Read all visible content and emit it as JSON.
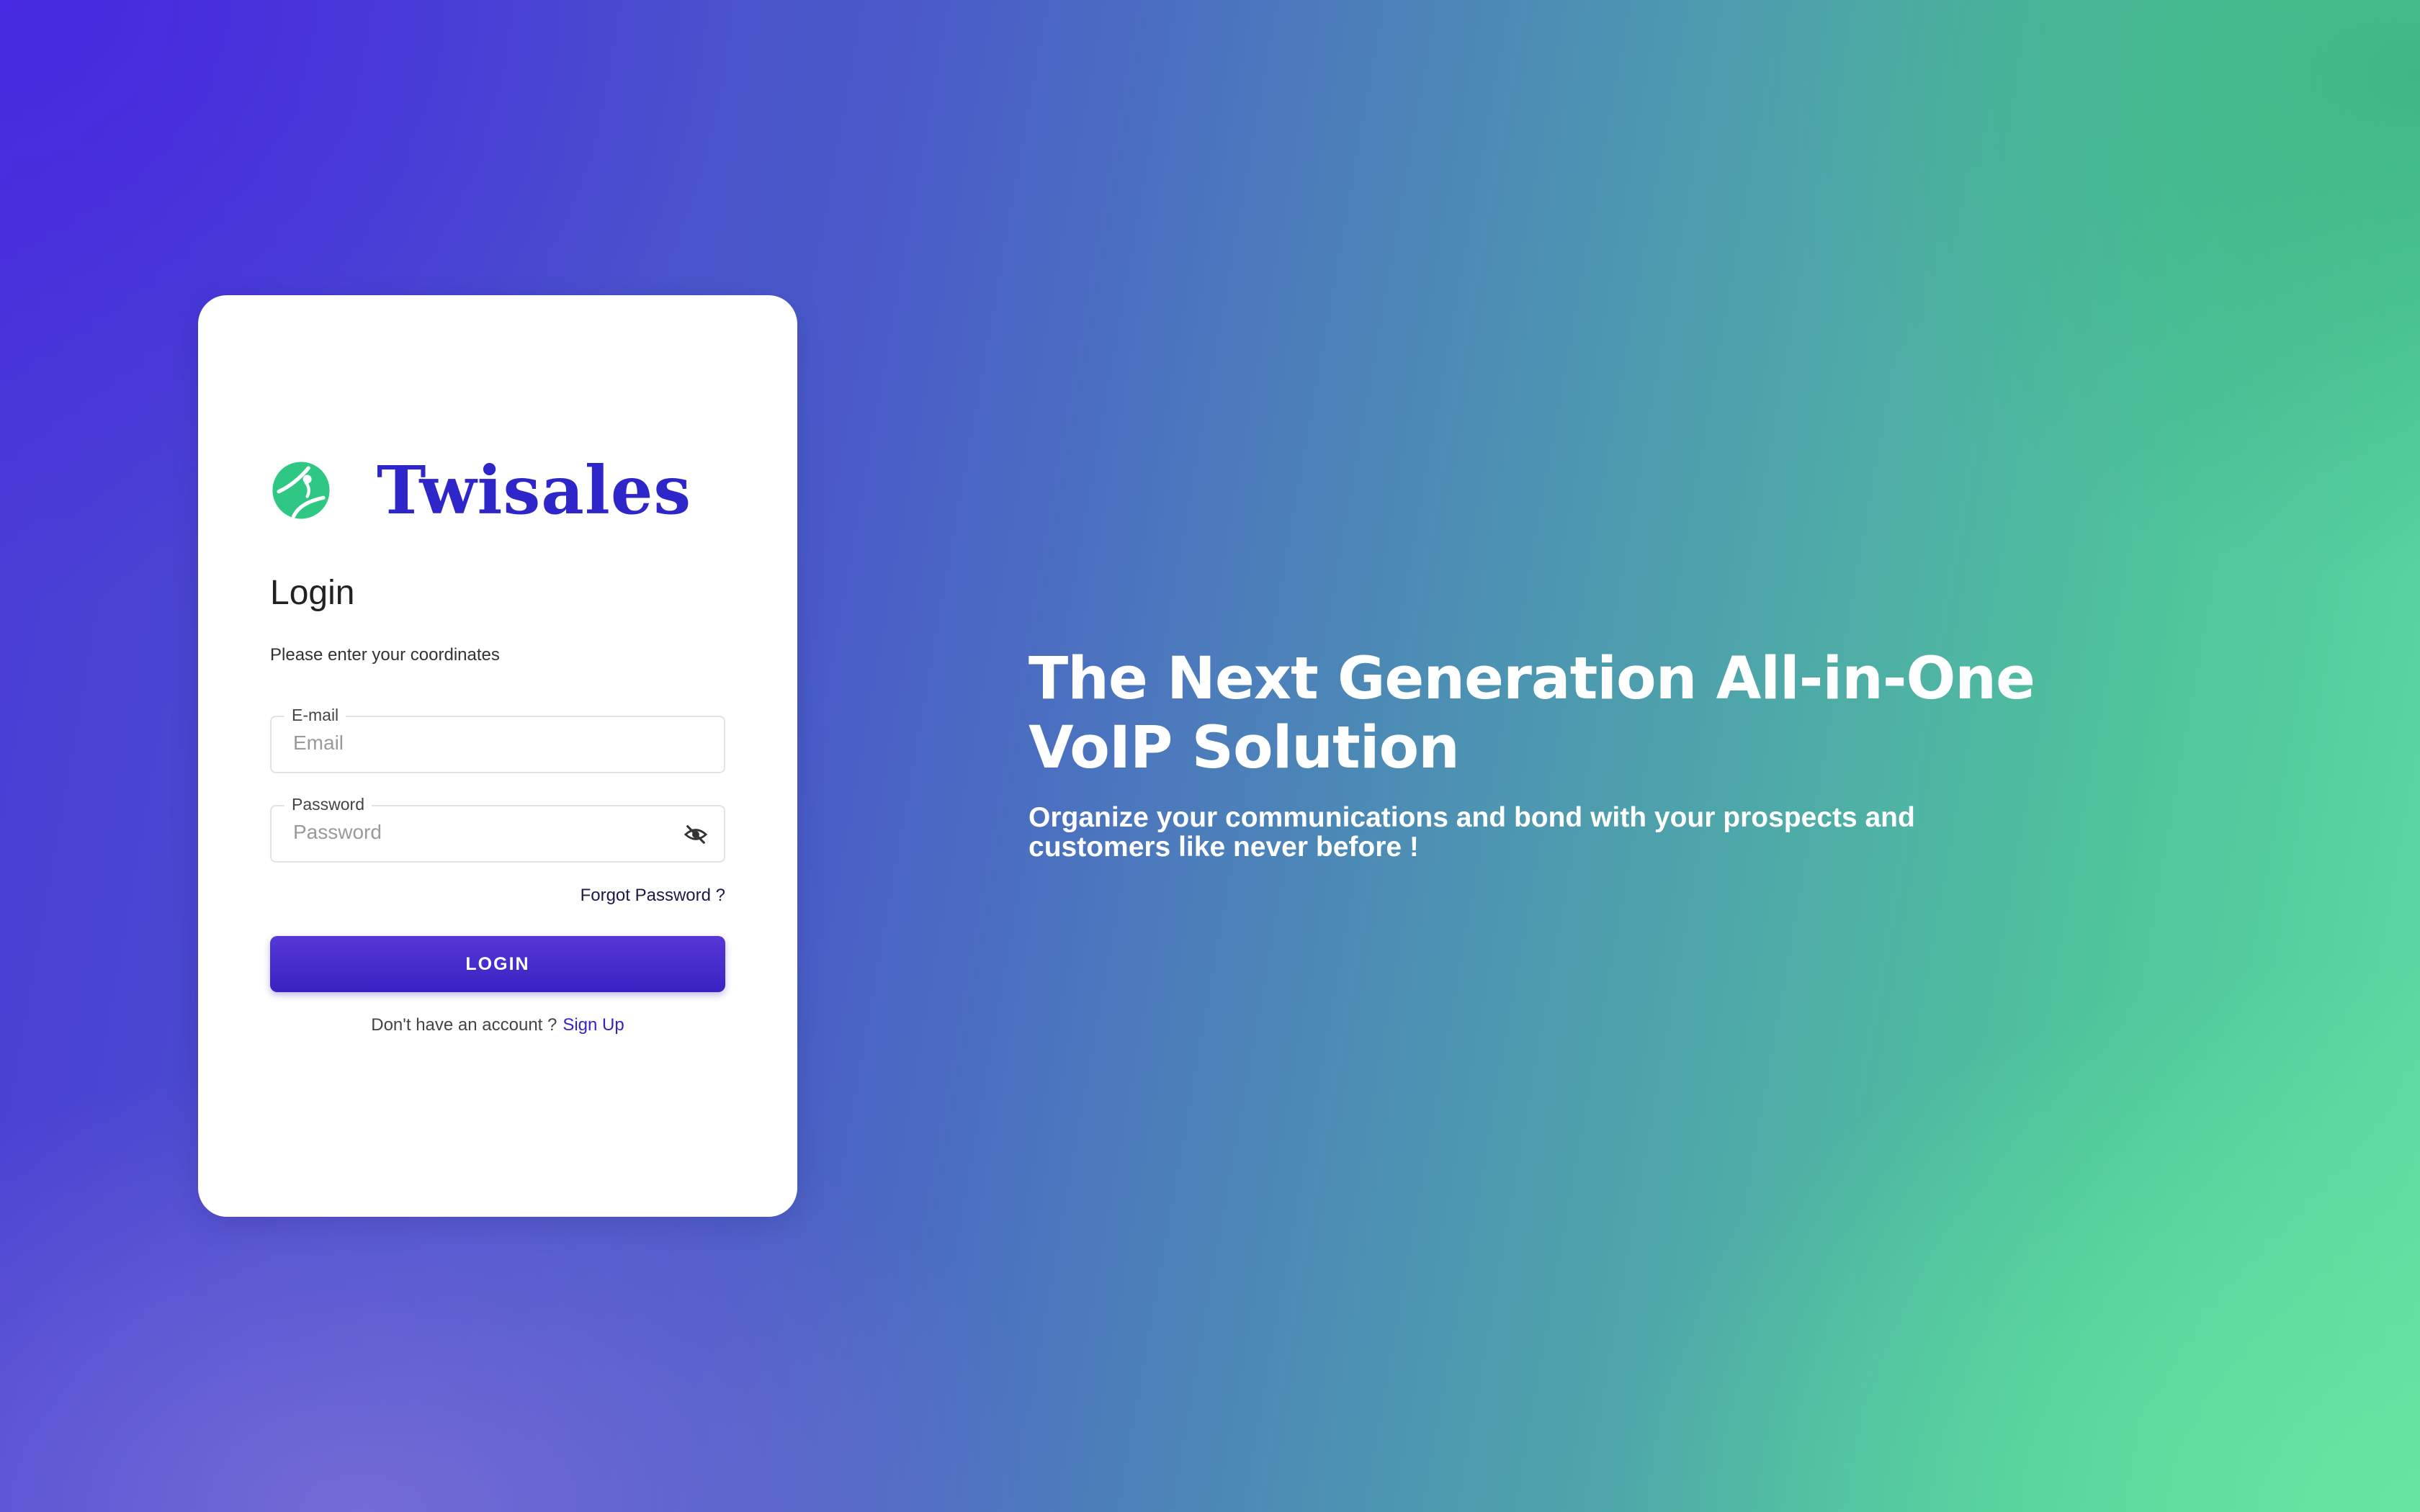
{
  "brand": {
    "name": "Twisales",
    "logo_icon": "globe-logo-icon",
    "logo_color": "#2ec783",
    "name_color": "#2f26c9"
  },
  "login": {
    "title": "Login",
    "subtitle": "Please enter your coordinates",
    "email": {
      "label": "E-mail",
      "placeholder": "Email",
      "value": ""
    },
    "password": {
      "label": "Password",
      "placeholder": "Password",
      "value": "",
      "toggle_icon": "eye-off-icon"
    },
    "forgot_label": "Forgot Password ?",
    "button_label": "LOGIN",
    "no_account_text": "Don't have an account ?",
    "signup_label": "Sign Up",
    "accent_color": "#3a22c2"
  },
  "hero": {
    "title_line1": "The Next Generation All-in-One",
    "title_line2": "VoIP Solution",
    "subtitle_line1": "Organize your communications and bond with your prospects and",
    "subtitle_line2": "customers like never before !"
  }
}
